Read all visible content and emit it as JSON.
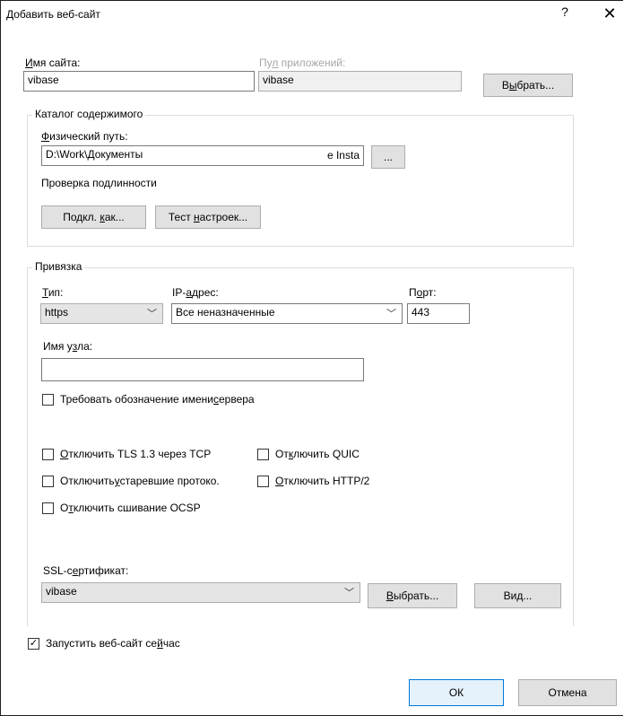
{
  "window": {
    "title": "Добавить веб-сайт",
    "help": "?",
    "close": "✕"
  },
  "site": {
    "name_label_u": "И",
    "name_label_rest": "мя сайта:",
    "name_value": "vibase",
    "pool_label_a": "Пу",
    "pool_label_u": "л",
    "pool_label_b": " приложений:",
    "pool_value": "vibase",
    "select_a": "В",
    "select_u": "ы",
    "select_b": "брать..."
  },
  "content": {
    "group_label": "Каталог содержимого",
    "path_label_u": "Ф",
    "path_label_rest": "изический путь:",
    "path_value_left": "D:\\Work\\Документы",
    "path_value_right": "e Insta",
    "browse": "...",
    "auth_label": "Проверка подлинности",
    "connect_a": "Подкл. ",
    "connect_u": "к",
    "connect_b": "ак...",
    "test_a": "Тест ",
    "test_u": "н",
    "test_b": "астроек..."
  },
  "binding": {
    "group_label": "Привязка",
    "type_label_u": "Т",
    "type_label_rest": "ип:",
    "type_value": "https",
    "ip_label_a": "IP-",
    "ip_label_u": "а",
    "ip_label_b": "дрес:",
    "ip_value": "Все неназначенные",
    "port_label_a": "П",
    "port_label_u": "о",
    "port_label_b": "рт:",
    "port_value": "443",
    "host_label_a": "Имя у",
    "host_label_u": "з",
    "host_label_b": "ла:",
    "host_value": "",
    "sni_a": "Требовать обозначение имени ",
    "sni_u": "с",
    "sni_b": "ервера",
    "tls_u": "О",
    "tls_rest": "тключить TLS 1.3 через TCP",
    "quic_a": "От",
    "quic_u": "к",
    "quic_b": "лючить QUIC",
    "legacy_a": "Отключить ",
    "legacy_u": "у",
    "legacy_b": "старевшие протоко.",
    "http2_u": "О",
    "http2_rest": "тключить HTTP/2",
    "ocsp_a": "О",
    "ocsp_u": "т",
    "ocsp_b": "ключить сшивание OCSP",
    "ssl_label_a": "SSL-с",
    "ssl_label_u": "е",
    "ssl_label_b": "ртификат:",
    "ssl_value": "vibase",
    "ssl_select_u": "В",
    "ssl_select_rest": "ыбрать...",
    "view_a": "Ви",
    "view_u": "д",
    "view_b": "..."
  },
  "start": {
    "a": "Запустить веб-сайт се",
    "u": "й",
    "b": "час",
    "checked": true,
    "mark": "✓"
  },
  "footer": {
    "ok": "ОК",
    "cancel": "Отмена"
  }
}
